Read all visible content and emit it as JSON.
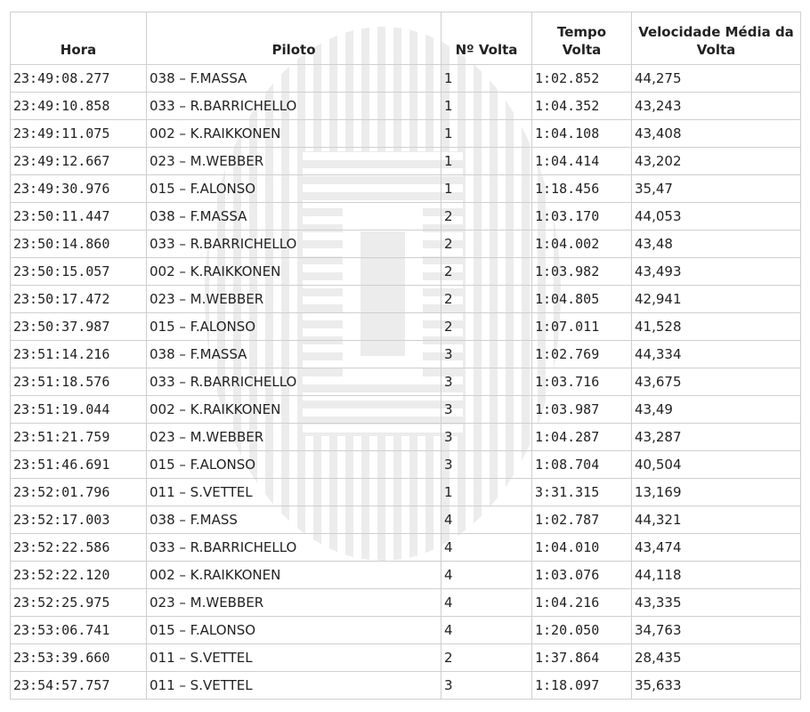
{
  "table": {
    "headers": {
      "hora": "Hora",
      "piloto": "Piloto",
      "volta": "Nº Volta",
      "tempo": "Tempo Volta",
      "velocidade": "Velocidade Média da Volta"
    },
    "rows": [
      {
        "hora": "23:49:08.277",
        "piloto": "038 – F.MASSA",
        "volta": "1",
        "tempo": "1:02.852",
        "velocidade": "44,275"
      },
      {
        "hora": "23:49:10.858",
        "piloto": "033 – R.BARRICHELLO",
        "volta": "1",
        "tempo": "1:04.352",
        "velocidade": "43,243"
      },
      {
        "hora": "23:49:11.075",
        "piloto": "002 – K.RAIKKONEN",
        "volta": "1",
        "tempo": "1:04.108",
        "velocidade": "43,408"
      },
      {
        "hora": "23:49:12.667",
        "piloto": "023 – M.WEBBER",
        "volta": "1",
        "tempo": "1:04.414",
        "velocidade": "43,202"
      },
      {
        "hora": "23:49:30.976",
        "piloto": "015 – F.ALONSO",
        "volta": "1",
        "tempo": "1:18.456",
        "velocidade": "35,47"
      },
      {
        "hora": "23:50:11.447",
        "piloto": "038 – F.MASSA",
        "volta": "2",
        "tempo": "1:03.170",
        "velocidade": "44,053"
      },
      {
        "hora": "23:50:14.860",
        "piloto": "033 – R.BARRICHELLO",
        "volta": "2",
        "tempo": "1:04.002",
        "velocidade": "43,48"
      },
      {
        "hora": "23:50:15.057",
        "piloto": "002 – K.RAIKKONEN",
        "volta": "2",
        "tempo": "1:03.982",
        "velocidade": "43,493"
      },
      {
        "hora": "23:50:17.472",
        "piloto": "023 – M.WEBBER",
        "volta": "2",
        "tempo": "1:04.805",
        "velocidade": "42,941"
      },
      {
        "hora": "23:50:37.987",
        "piloto": "015 – F.ALONSO",
        "volta": "2",
        "tempo": "1:07.011",
        "velocidade": "41,528"
      },
      {
        "hora": "23:51:14.216",
        "piloto": "038 – F.MASSA",
        "volta": "3",
        "tempo": "1:02.769",
        "velocidade": "44,334"
      },
      {
        "hora": "23:51:18.576",
        "piloto": "033 – R.BARRICHELLO",
        "volta": "3",
        "tempo": "1:03.716",
        "velocidade": "43,675"
      },
      {
        "hora": "23:51:19.044",
        "piloto": "002 – K.RAIKKONEN",
        "volta": "3",
        "tempo": "1:03.987",
        "velocidade": "43,49"
      },
      {
        "hora": "23:51:21.759",
        "piloto": "023 – M.WEBBER",
        "volta": "3",
        "tempo": "1:04.287",
        "velocidade": "43,287"
      },
      {
        "hora": "23:51:46.691",
        "piloto": "015 – F.ALONSO",
        "volta": "3",
        "tempo": "1:08.704",
        "velocidade": "40,504"
      },
      {
        "hora": "23:52:01.796",
        "piloto": "011 – S.VETTEL",
        "volta": "1",
        "tempo": "3:31.315",
        "velocidade": "13,169"
      },
      {
        "hora": "23:52:17.003",
        "piloto": "038 – F.MASS",
        "volta": "4",
        "tempo": "1:02.787",
        "velocidade": "44,321"
      },
      {
        "hora": "23:52:22.586",
        "piloto": "033 – R.BARRICHELLO",
        "volta": "4",
        "tempo": "1:04.010",
        "velocidade": "43,474"
      },
      {
        "hora": "23:52:22.120",
        "piloto": "002 – K.RAIKKONEN",
        "volta": "4",
        "tempo": "1:03.076",
        "velocidade": "44,118"
      },
      {
        "hora": "23:52:25.975",
        "piloto": "023 – M.WEBBER",
        "volta": "4",
        "tempo": "1:04.216",
        "velocidade": "43,335"
      },
      {
        "hora": "23:53:06.741",
        "piloto": "015 – F.ALONSO",
        "volta": "4",
        "tempo": "1:20.050",
        "velocidade": "34,763"
      },
      {
        "hora": "23:53:39.660",
        "piloto": "011 – S.VETTEL",
        "volta": "2",
        "tempo": "1:37.864",
        "velocidade": "28,435"
      },
      {
        "hora": "23:54:57.757",
        "piloto": "011 – S.VETTEL",
        "volta": "3",
        "tempo": "1:18.097",
        "velocidade": "35,633"
      }
    ]
  },
  "watermark": {
    "icon": "striped-globe-watermark-icon",
    "color": "#ececec"
  },
  "colors": {
    "text": "#222222",
    "border": "#cfcfcf",
    "background": "#ffffff"
  }
}
